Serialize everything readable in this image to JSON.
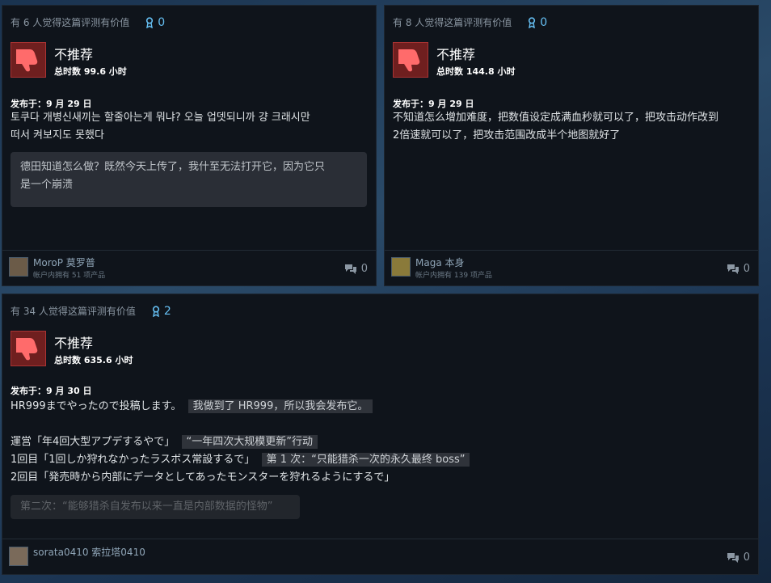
{
  "reviews": [
    {
      "helpful": "有 6 人觉得这篇评测有价值",
      "awards": "0",
      "verdict": "不推荐",
      "hours": "总时数 99.6 小时",
      "posted": "发布于：9 月 29 日",
      "body_lines": [
        "토쿠다 개병신새끼는 할줄아는게 뭐냐? 오늘 업뎃되니까 걍 크래시만",
        "떠서 켜보지도 못했다"
      ],
      "translation_lines": [
        "德田知道怎么做？既然今天上传了，我什至无法打开它，因为它只",
        "是一个崩溃"
      ],
      "author": "MoroP  莫罗普",
      "owns": "帐户内拥有 51 项产品",
      "comments": "0"
    },
    {
      "helpful": "有 8 人觉得这篇评测有价值",
      "awards": "0",
      "verdict": "不推荐",
      "hours": "总时数 144.8 小时",
      "posted": "发布于：9 月 29 日",
      "body_lines": [
        "不知道怎么增加难度，把数值设定成满血秒就可以了，把攻击动作改到",
        "2倍速就可以了，把攻击范围改成半个地图就好了"
      ],
      "author": "Maga  本身",
      "owns": "帐户内拥有 139 项产品",
      "comments": "0"
    },
    {
      "helpful": "有 34 人觉得这篇评测有价值",
      "awards": "2",
      "verdict": "不推荐",
      "hours": "总时数 635.6 小时",
      "posted": "发布于：9 月 30 日",
      "line1": "HR999までやったので投稿します。",
      "line1_tr": "我做到了 HR999，所以我会发布它。",
      "line2": "運営「年4回大型アプデするやで」",
      "line2_tr": "“一年四次大规模更新”行动",
      "line3": "1回目「1回しか狩れなかったラスボス常設するで」",
      "line3_tr": "第 1 次：“只能猎杀一次的永久最终 boss”",
      "line4": "2回目「発売時から内部にデータとしてあったモンスターを狩れるようにするで」",
      "line4_tr": "第二次：“能够猎杀自发布以来一直是内部数据的怪物”",
      "author": "sorata0410  索拉塔0410",
      "comments": "0"
    }
  ],
  "icons": {
    "award": "award-ribbon-icon",
    "thumb": "thumbs-down-icon",
    "comment": "speech-bubbles-icon"
  },
  "colors": {
    "panel": "#0f141b",
    "accent": "#66c0f4",
    "thumb_bg": "#6f1f1f"
  }
}
